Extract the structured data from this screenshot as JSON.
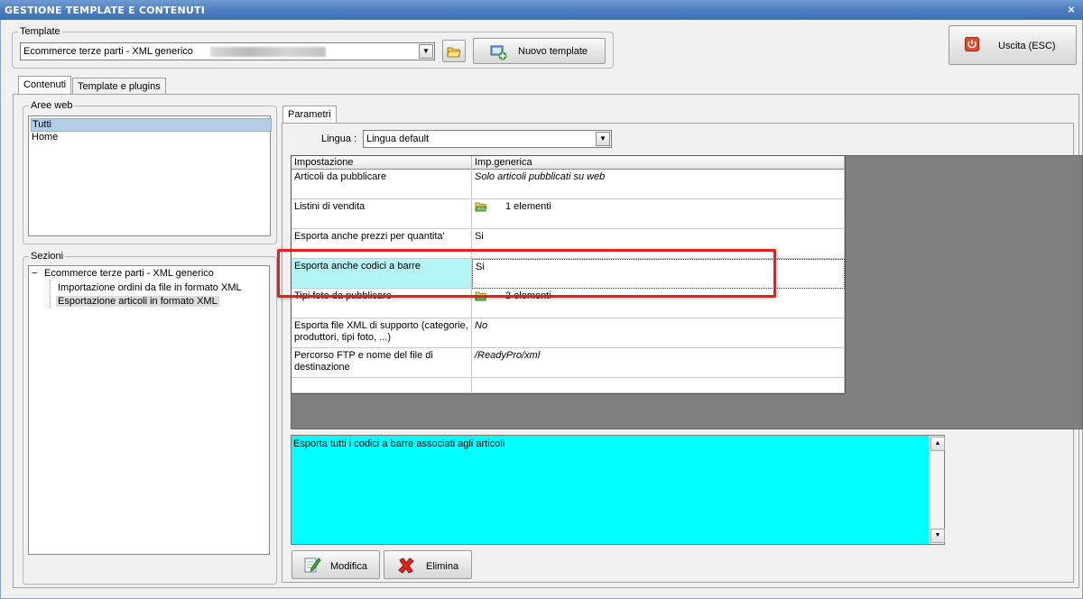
{
  "window": {
    "title": "GESTIONE TEMPLATE E CONTENUTI",
    "close": "×"
  },
  "template_group": {
    "legend": "Template",
    "selected": "Ecommerce terze parti - XML generico",
    "new_button": "Nuovo template"
  },
  "exit_button": "Uscita (ESC)",
  "tabs": [
    {
      "label": "Contenuti",
      "active": true
    },
    {
      "label": "Template e plugins",
      "active": false
    }
  ],
  "aree_web": {
    "legend": "Aree web",
    "items": [
      "Tutti",
      "Home"
    ],
    "selected_index": 0
  },
  "sezioni": {
    "legend": "Sezioni",
    "root": "Ecommerce terze parti - XML generico",
    "expander": "−",
    "children": [
      "Importazione ordini da file in formato XML",
      "Esportazione articoli in formato XML"
    ],
    "selected_index": 1
  },
  "parametri": {
    "tab": "Parametri",
    "lingua_label": "Lingua :",
    "lingua_value": "Lingua default",
    "columns": [
      "Impostazione",
      "Imp.generica"
    ],
    "rows": [
      {
        "setting": "Articoli da pubblicare",
        "value": "Solo articoli pubblicati su web"
      },
      {
        "setting": "Listini di vendita",
        "value": "1 elementi"
      },
      {
        "setting": "Esporta anche prezzi per quantita'",
        "value": "Si"
      },
      {
        "setting": "Esporta anche codici a barre",
        "value": "Si"
      },
      {
        "setting": "Tipi foto da pubblicare",
        "value": "2 elementi"
      },
      {
        "setting": "Esporta file XML di supporto (categorie, produttori, tipi foto, ...)",
        "value": "No"
      },
      {
        "setting": "Percorso FTP e nome del file di destinazione",
        "value": "/ReadyPro/xml"
      },
      {
        "setting": "",
        "value": ""
      }
    ],
    "description": "Esporta tutti i codici a barre associati agli articoli"
  },
  "actions": {
    "modify": "Modifica",
    "delete": "Elimina"
  },
  "colors": {
    "highlight": "#b3f4f4",
    "description_bg": "#00ffff",
    "annotation": "#e32020",
    "grid_bg": "#7f7f7f"
  }
}
